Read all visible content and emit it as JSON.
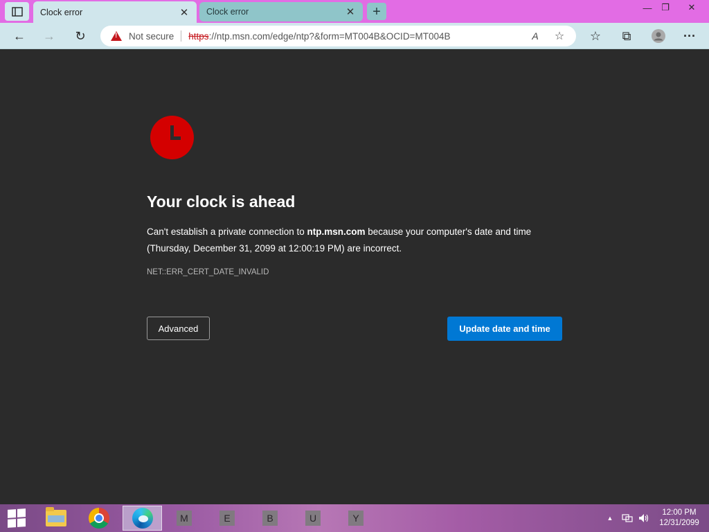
{
  "browser": {
    "tabs": [
      {
        "title": "Clock error",
        "active": true
      },
      {
        "title": "Clock error",
        "active": false
      }
    ],
    "new_tab_glyph": "+",
    "close_glyph": "✕",
    "window_controls": {
      "minimize": "—",
      "restore": "❐",
      "close": "✕"
    }
  },
  "toolbar": {
    "back_glyph": "←",
    "forward_glyph": "→",
    "refresh_glyph": "↻",
    "address": {
      "security_label": "Not secure",
      "scheme": "https",
      "url_rest": "://ntp.msn.com/edge/ntp?&form=MT004B&OCID=MT004B"
    },
    "read_aloud_glyph": "A",
    "add_favorite_glyph": "☆",
    "favorites_glyph": "☆",
    "collections_glyph": "⧉",
    "more_glyph": "···"
  },
  "page": {
    "headline": "Your clock is ahead",
    "desc_prefix": "Can't establish a private connection to ",
    "desc_host": "ntp.msn.com",
    "desc_suffix": " because your computer's date and time (Thursday, December 31, 2099 at 12:00:19 PM) are incorrect.",
    "error_code": "NET::ERR_CERT_DATE_INVALID",
    "advanced_label": "Advanced",
    "update_label": "Update date and time"
  },
  "taskbar": {
    "letter_apps": [
      "M",
      "E",
      "B",
      "U",
      "Y"
    ],
    "tray": {
      "chevron": "▲"
    },
    "time": "12:00 PM",
    "date": "12/31/2099"
  },
  "colors": {
    "accent": "#0078d4",
    "error_red": "#d40000",
    "page_bg": "#2b2b2b"
  }
}
